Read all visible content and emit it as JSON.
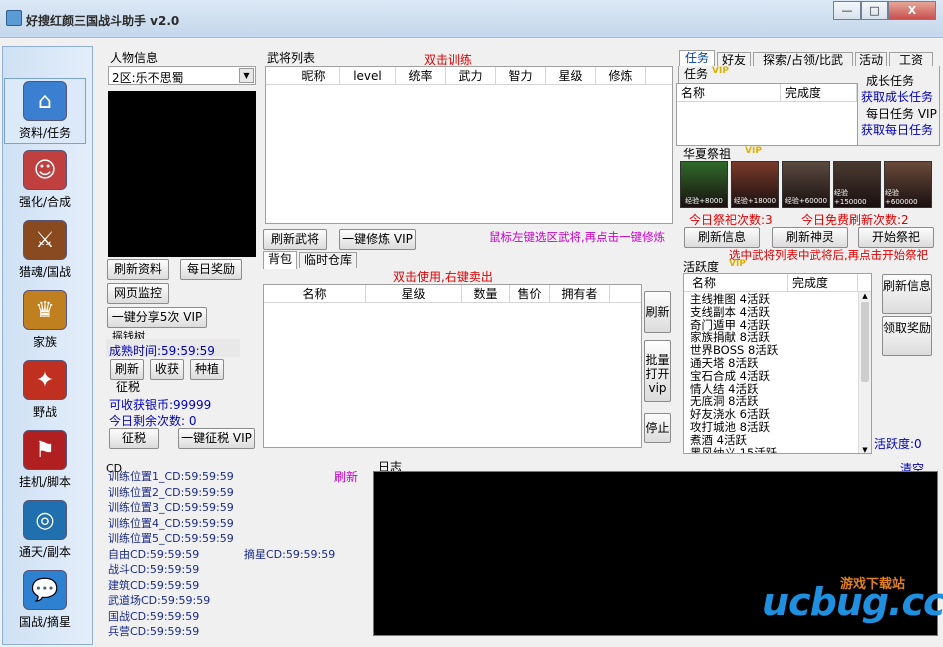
{
  "window": {
    "title": "好搜红颜三国战斗助手 v2.0",
    "minimize": "—",
    "restore": "□",
    "close": "X"
  },
  "nav": [
    {
      "label": "资料/任务",
      "icon": "home-icon",
      "color": "#3a7fd0"
    },
    {
      "label": "强化/合成",
      "icon": "character-icon",
      "color": "#c04040"
    },
    {
      "label": "猎魂/国战",
      "icon": "war-icon",
      "color": "#8a4a20"
    },
    {
      "label": "家族",
      "icon": "family-icon",
      "color": "#c08020"
    },
    {
      "label": "野战",
      "icon": "field-battle-icon",
      "color": "#c03020"
    },
    {
      "label": "挂机/脚本",
      "icon": "autoplay-icon",
      "color": "#b02020"
    },
    {
      "label": "通天/副本",
      "icon": "dungeon-icon",
      "color": "#2070b0"
    },
    {
      "label": "国战/摘星",
      "icon": "chat-bubble-icon",
      "color": "#2e80d0"
    }
  ],
  "profile": {
    "group_title": "人物信息",
    "server_select": "2区:乐不思蜀",
    "refresh_btn": "刷新资料",
    "daily_reward_btn": "每日奖励",
    "web_monitor_btn": "网页监控",
    "share_btn": "一键分享5次 VIP"
  },
  "money_tree": {
    "title": "摇钱树",
    "mature_label": "成熟时间:59:59:59",
    "refresh_btn": "刷新",
    "harvest_btn": "收获",
    "plant_btn": "种植"
  },
  "tax": {
    "title": "征税",
    "silver_label": "可收获银币:99999",
    "remaining_label": "今日剩余次数: 0",
    "tax_btn": "征税",
    "auto_tax_btn": "一键征税 VIP"
  },
  "generals": {
    "title": "武将列表",
    "hint": "双击训练",
    "columns": [
      "昵称",
      "level",
      "统率",
      "武力",
      "智力",
      "星级",
      "修炼"
    ],
    "refresh_btn": "刷新武将",
    "train_btn": "一键修炼 VIP",
    "footer_hint": "鼠标左键选区武将,再点击一键修炼"
  },
  "bag": {
    "tabs": [
      "背包",
      "临时仓库"
    ],
    "hint": "双击使用,右键卖出",
    "columns": [
      "名称",
      "星级",
      "数量",
      "售价",
      "拥有者"
    ],
    "refresh_btn": "刷新",
    "batch_open_btn": "批量打开vip",
    "stop_btn": "停止"
  },
  "right_tabs": [
    "任务",
    "好友",
    "探索/占领/比武",
    "活动",
    "工资"
  ],
  "tasks": {
    "group_title": "任务",
    "columns": [
      "名称",
      "完成度"
    ],
    "growth_title": "成长任务",
    "growth_btn": "获取成长任务",
    "daily_title": "每日任务 VIP",
    "daily_btn": "获取每日任务"
  },
  "sacrifice": {
    "title": "华夏祭祖",
    "heroes": [
      {
        "name": "hero-1",
        "bg": "#2f6a2a",
        "cost": "经验+8000"
      },
      {
        "name": "hero-2",
        "bg": "#7a3a2a",
        "cost": "经验+18000"
      },
      {
        "name": "hero-3",
        "bg": "#5a4a40",
        "cost": "经验+60000"
      },
      {
        "name": "hero-4",
        "bg": "#4a3a30",
        "cost": "经验+150000"
      },
      {
        "name": "hero-5",
        "bg": "#6a4a3a",
        "cost": "经验+600000"
      }
    ],
    "today_count": "今日祭祀次数:3",
    "free_refresh": "今日免费刷新次数:2",
    "refresh_info_btn": "刷新信息",
    "refresh_spirit_btn": "刷新神灵",
    "start_btn": "开始祭祀",
    "hint": "选中武将列表中武将后,再点击开始祭祀"
  },
  "activity": {
    "title": "活跃度",
    "columns": [
      "名称",
      "完成度"
    ],
    "items": [
      "主线推图 4活跃",
      "支线副本 4活跃",
      "奇门遁甲 4活跃",
      "家族捐献 8活跃",
      "世界BOSS 8活跃",
      "通天塔 8活跃",
      "宝石合成 4活跃",
      "情人结 4活跃",
      "无底洞 8活跃",
      "好友浇水 6活跃",
      "攻打城池 8活跃",
      "煮酒 4活跃",
      "黑风纳义 15活跃"
    ],
    "refresh_btn": "刷新信息",
    "claim_btn": "领取奖励",
    "score": "活跃度:0"
  },
  "cd": {
    "title": "CD",
    "refresh": "刷新",
    "lines": [
      "训练位置1_CD:59:59:59",
      "训练位置2_CD:59:59:59",
      "训练位置3_CD:59:59:59",
      "训练位置4_CD:59:59:59",
      "训练位置5_CD:59:59:59",
      "自由CD:59:59:59",
      "战斗CD:59:59:59",
      "建筑CD:59:59:59",
      "武道场CD:59:59:59",
      "国战CD:59:59:59",
      "兵营CD:59:59:59"
    ],
    "pick_star": "摘星CD:59:59:59"
  },
  "log": {
    "title": "日志",
    "clear": "清空"
  },
  "watermark": {
    "text": "ucbug.cc",
    "subtitle": "游戏下载站"
  }
}
